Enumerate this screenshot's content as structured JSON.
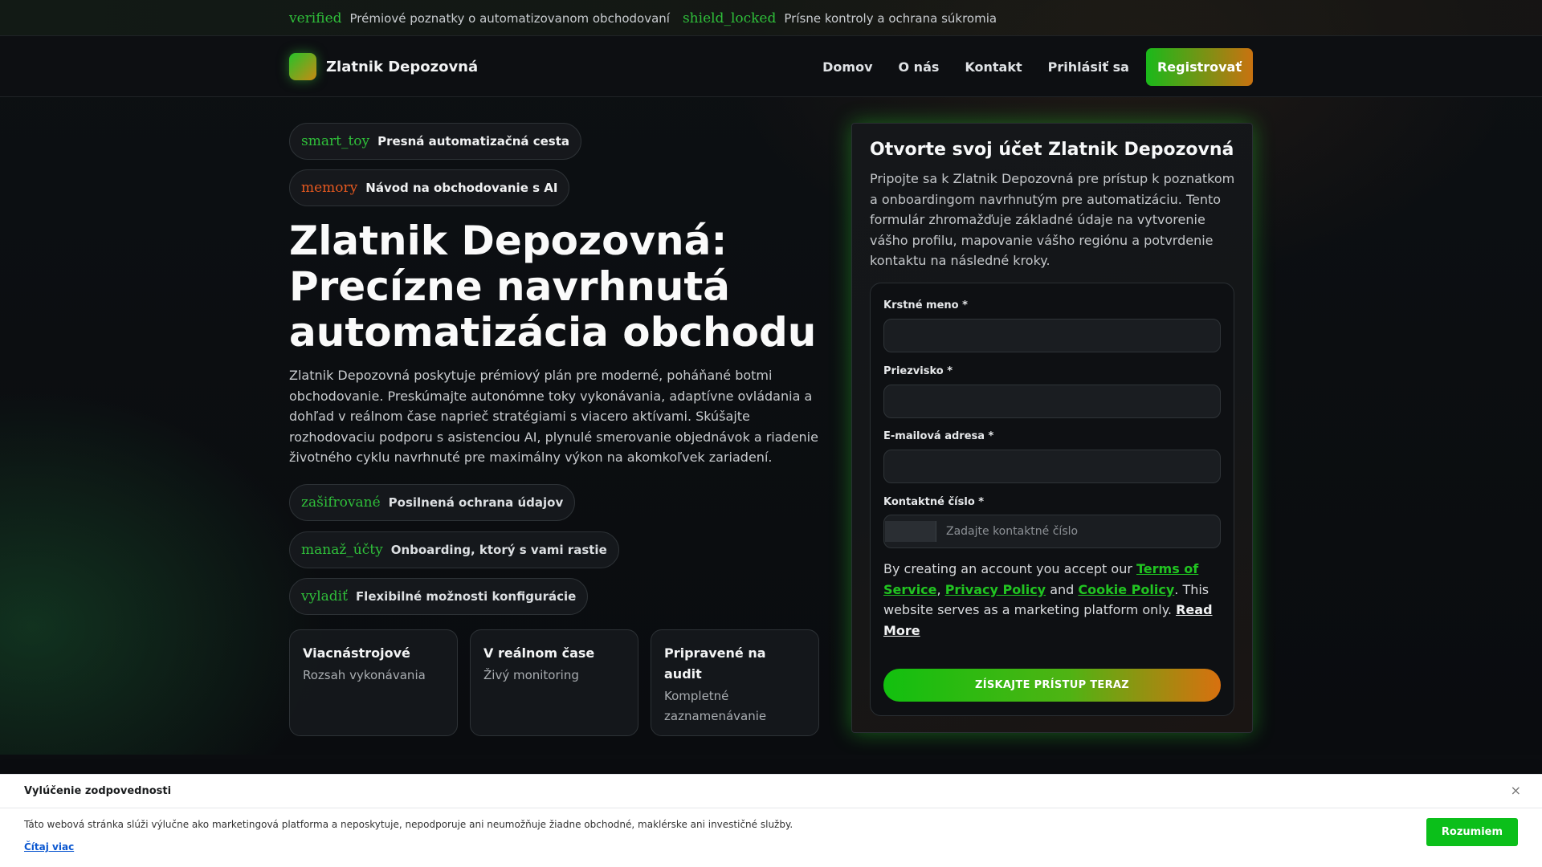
{
  "topbar": {
    "items": [
      {
        "icon": "verified",
        "text": "Prémiové poznatky o automatizovanom obchodovaní"
      },
      {
        "icon": "shield_locked",
        "text": "Prísne kontroly a ochrana súkromia"
      }
    ]
  },
  "header": {
    "brand": "Zlatnik Depozovná",
    "nav": [
      "Domov",
      "O nás",
      "Kontakt",
      "Prihlásiť sa"
    ],
    "register": "Registrovať"
  },
  "hero": {
    "badges": [
      {
        "icon": "smart_toy",
        "text": "Presná automatizačná cesta"
      },
      {
        "icon": "memory",
        "text": "Návod na obchodovanie s AI"
      }
    ],
    "title": "Zlatnik Depozovná: Precízne navrhnutá automatizácia obchodu",
    "description": "Zlatnik Depozovná poskytuje prémiový plán pre moderné, poháňané botmi obchodovanie. Preskúmajte autonómne toky vykonávania, adaptívne ovládania a dohľad v reálnom čase naprieč stratégiami s viacero aktívami. Skúšajte rozhodovaciu podporu s asistenciou AI, plynulé smerovanie objednávok a riadenie životného cyklu navrhnuté pre maximálny výkon na akomkoľvek zariadení.",
    "features": [
      {
        "icon": "zašifrované",
        "text": "Posilnená ochrana údajov"
      },
      {
        "icon": "manaž_účty",
        "text": "Onboarding, ktorý s vami rastie"
      },
      {
        "icon": "vyladiť",
        "text": "Flexibilné možnosti konfigurácie"
      }
    ],
    "stats": [
      {
        "title": "Viacnástrojové",
        "subtitle": "Rozsah vykonávania"
      },
      {
        "title": "V reálnom čase",
        "subtitle": "Živý monitoring"
      },
      {
        "title": "Pripravené na audit",
        "subtitle": "Kompletné zaznamenávanie"
      }
    ]
  },
  "form": {
    "title": "Otvorte svoj účet Zlatnik Depozovná",
    "description": "Pripojte sa k Zlatnik Depozovná pre prístup k poznatkom a onboardingom navrhnutým pre automatizáciu. Tento formulár zhromažďuje základné údaje na vytvorenie vášho profilu, mapovanie vášho regiónu a potvrdenie kontaktu na následné kroky.",
    "first_name_label": "Krstné meno *",
    "last_name_label": "Priezvisko *",
    "email_label": "E-mailová adresa *",
    "phone_label": "Kontaktné číslo *",
    "phone_placeholder": "Zadajte kontaktné číslo",
    "consent_prefix": "By creating an account you accept our ",
    "terms": "Terms of Service",
    "comma": ", ",
    "privacy": "Privacy Policy",
    "and": " and ",
    "cookie": "Cookie Policy",
    "consent_suffix": ". This website serves as a marketing platform only. ",
    "read_more": "Read More",
    "submit": "ZÍSKAJTE PRÍSTUP TERAZ"
  },
  "disclaimer": {
    "title": "Vylúčenie zodpovednosti",
    "close": "×",
    "text": "Táto webová stránka slúži výlučne ako marketingová platforma a neposkytuje, nepodporuje ani neumožňuje žiadne obchodné, maklérske ani investičné služby.",
    "more": "Čítaj viac",
    "accept": "Rozumiem"
  },
  "colors": {
    "accent_green": "#21c421",
    "accent_orange": "#c97210",
    "background": "#0b0d10"
  }
}
